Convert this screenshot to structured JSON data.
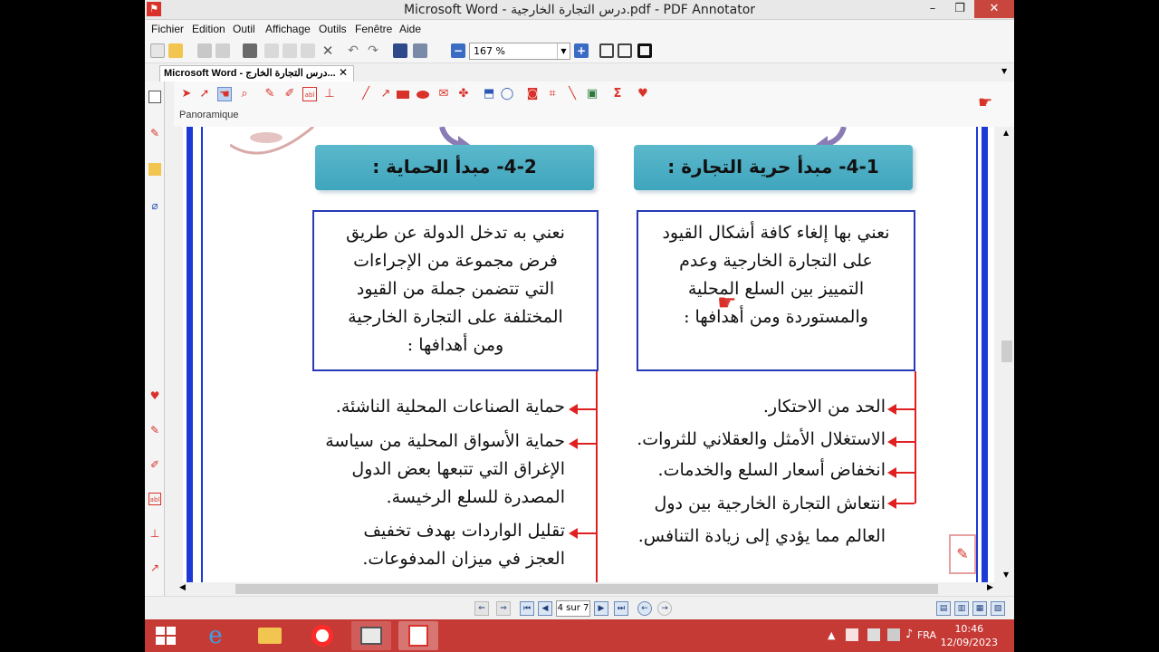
{
  "window": {
    "title": "Microsoft Word - درس التجارة الخارجية.pdf - PDF Annotator",
    "minimize": "–",
    "maximize": "❐",
    "close": "✕"
  },
  "menu": [
    "Fichier",
    "Edition",
    "Outil",
    "Affichage",
    "Outils",
    "Fenêtre",
    "Aide"
  ],
  "toolbar": {
    "zoom": "167 %"
  },
  "tab": {
    "label": "Microsoft Word - درس التجارة الخارج...",
    "close": "✕"
  },
  "annot_toolbar": {
    "mode_label": "Panoramique"
  },
  "document": {
    "right_header": "4-1- مبدأ حرية التجارة :",
    "left_header": "4-2- مبدأ الحماية :",
    "right_box": [
      "نعني بها إلغاء كافة أشكال القيود",
      "على التجارة الخارجية وعدم",
      "التمييز بين السلع المحلية",
      "والمستوردة ومن أهدافها :"
    ],
    "left_box": [
      "نعني به تدخل الدولة عن طريق",
      "فرض مجموعة من الإجراءات",
      "التي تتضمن جملة من القيود",
      "المختلفة على التجارة الخارجية",
      "ومن أهدافها :"
    ],
    "right_bullets": [
      [
        "الحد من الاحتكار."
      ],
      [
        "الاستغلال الأمثل والعقلاني للثروات."
      ],
      [
        "انخفاض أسعار السلع والخدمات."
      ],
      [
        "انتعاش التجارة الخارجية بين دول",
        "العالم مما يؤدي إلى زيادة التنافس."
      ]
    ],
    "left_bullets": [
      [
        "حماية الصناعات المحلية الناشئة."
      ],
      [
        "حماية الأسواق المحلية من سياسة",
        "الإغراق التي تتبعها بعض الدول",
        "المصدرة للسلع الرخيسة."
      ],
      [
        "تقليل الواردات بهدف تخفيف",
        "العجز في ميزان المدفوعات."
      ]
    ]
  },
  "navigation": {
    "page": "4 sur 7"
  },
  "taskbar": {
    "lang": "FRA",
    "time": "10:46",
    "date": "12/09/2023"
  }
}
